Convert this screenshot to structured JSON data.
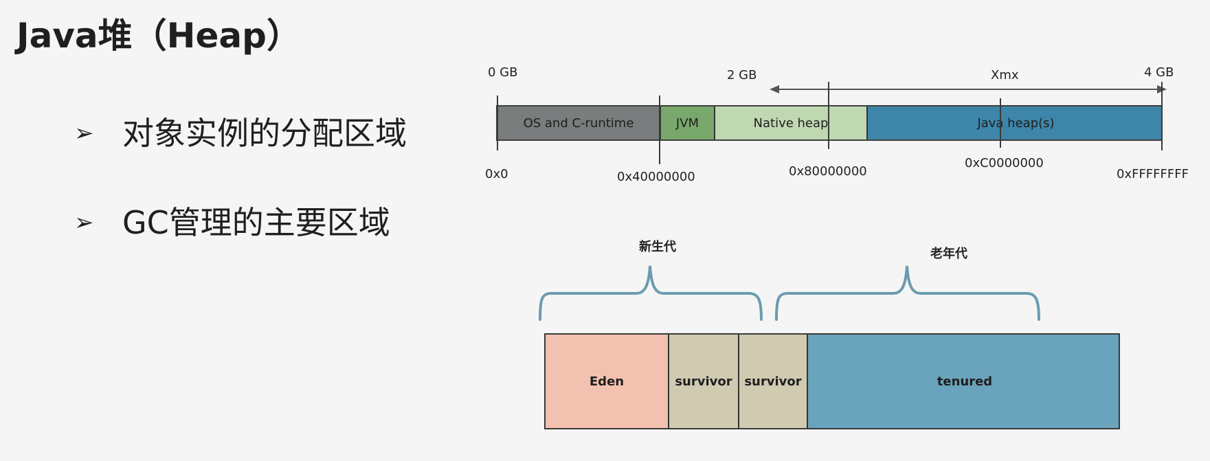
{
  "title": "Java堆（Heap）",
  "bullets": [
    {
      "icon": "arrow-bullet-icon",
      "glyph": "➢",
      "text": "对象实例的分配区域"
    },
    {
      "icon": "arrow-bullet-icon",
      "glyph": "➢",
      "text": "GC管理的主要区域"
    }
  ],
  "memory_map": {
    "top_labels": {
      "start": "0 GB",
      "mid": "2 GB",
      "end": "4 GB",
      "xmx": "Xmx"
    },
    "segments": [
      {
        "label": "OS and C-runtime",
        "color": "#7a7d7d"
      },
      {
        "label": "JVM",
        "color": "#79a86d"
      },
      {
        "label": "Native heap",
        "color": "#bfd8b2"
      },
      {
        "label": "Java heap(s)",
        "color": "#3d86a9"
      }
    ],
    "addresses": {
      "a0": "0x0",
      "a1": "0x40000000",
      "a2": "0x80000000",
      "a3": "0xC0000000",
      "a4": "0xFFFFFFFF"
    }
  },
  "generations": {
    "young_label": "新生代",
    "old_label": "老年代",
    "brace_color": "#6b9bb0",
    "segments": [
      {
        "label": "Eden",
        "color": "#f3c1b0"
      },
      {
        "label": "survivor",
        "color": "#d0cbb0"
      },
      {
        "label": "survivor",
        "color": "#d0cbb0"
      },
      {
        "label": "tenured",
        "color": "#6aa3bc"
      }
    ]
  }
}
